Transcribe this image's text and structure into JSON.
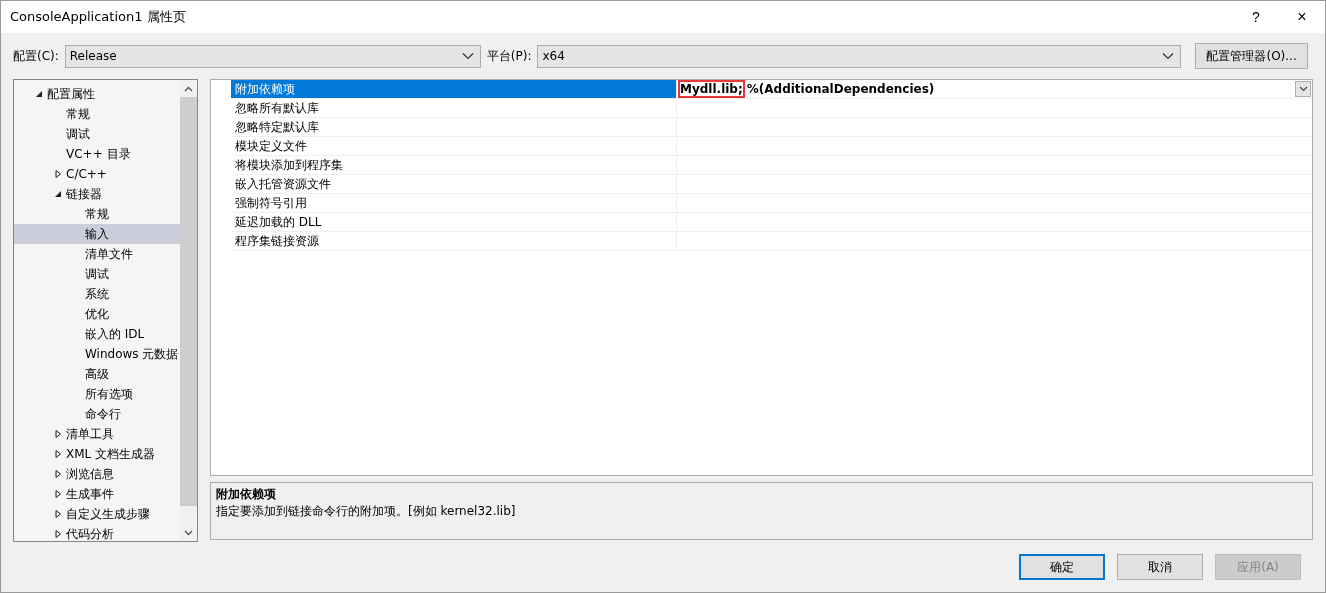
{
  "window": {
    "title": "ConsoleApplication1 属性页",
    "help": "?",
    "close": "×"
  },
  "config_bar": {
    "configuration_label": "配置(C):",
    "configuration": "Release",
    "platform_label": "平台(P):",
    "platform": "x64",
    "manager_button": "配置管理器(O)..."
  },
  "tree": [
    {
      "label": "配置属性",
      "expanded": true,
      "selected": false,
      "children": [
        {
          "label": "常规",
          "selected": false
        },
        {
          "label": "调试",
          "selected": false
        },
        {
          "label": "VC++ 目录",
          "selected": false
        },
        {
          "label": "C/C++",
          "expanded": false,
          "selected": false
        },
        {
          "label": "链接器",
          "expanded": true,
          "selected": false,
          "children": [
            {
              "label": "常规",
              "selected": false
            },
            {
              "label": "输入",
              "selected": true
            },
            {
              "label": "清单文件",
              "selected": false
            },
            {
              "label": "调试",
              "selected": false
            },
            {
              "label": "系统",
              "selected": false
            },
            {
              "label": "优化",
              "selected": false
            },
            {
              "label": "嵌入的 IDL",
              "selected": false
            },
            {
              "label": "Windows 元数据",
              "selected": false
            },
            {
              "label": "高级",
              "selected": false
            },
            {
              "label": "所有选项",
              "selected": false
            },
            {
              "label": "命令行",
              "selected": false
            }
          ]
        },
        {
          "label": "清单工具",
          "expanded": false,
          "selected": false
        },
        {
          "label": "XML 文档生成器",
          "expanded": false,
          "selected": false
        },
        {
          "label": "浏览信息",
          "expanded": false,
          "selected": false
        },
        {
          "label": "生成事件",
          "expanded": false,
          "selected": false
        },
        {
          "label": "自定义生成步骤",
          "expanded": false,
          "selected": false
        },
        {
          "label": "代码分析",
          "expanded": false,
          "selected": false
        }
      ]
    }
  ],
  "properties": [
    {
      "name": "附加依赖项",
      "selected": true,
      "value_parts": [
        {
          "text": "Mydll.lib;",
          "marked": true
        },
        {
          "text": "%(AdditionalDependencies)",
          "marked": false
        }
      ]
    },
    {
      "name": "忽略所有默认库",
      "selected": false
    },
    {
      "name": "忽略特定默认库",
      "selected": false
    },
    {
      "name": "模块定义文件",
      "selected": false
    },
    {
      "name": "将模块添加到程序集",
      "selected": false
    },
    {
      "name": "嵌入托管资源文件",
      "selected": false
    },
    {
      "name": "强制符号引用",
      "selected": false
    },
    {
      "name": "延迟加载的 DLL",
      "selected": false
    },
    {
      "name": "程序集链接资源",
      "selected": false
    }
  ],
  "description": {
    "title": "附加依赖项",
    "text": "指定要添加到链接命令行的附加项。[例如 kernel32.lib]"
  },
  "buttons": [
    {
      "label": "确定",
      "kind": "default",
      "disabled": false
    },
    {
      "label": "取消",
      "kind": "normal",
      "disabled": false
    },
    {
      "label": "应用(A)",
      "kind": "normal",
      "disabled": true
    }
  ]
}
